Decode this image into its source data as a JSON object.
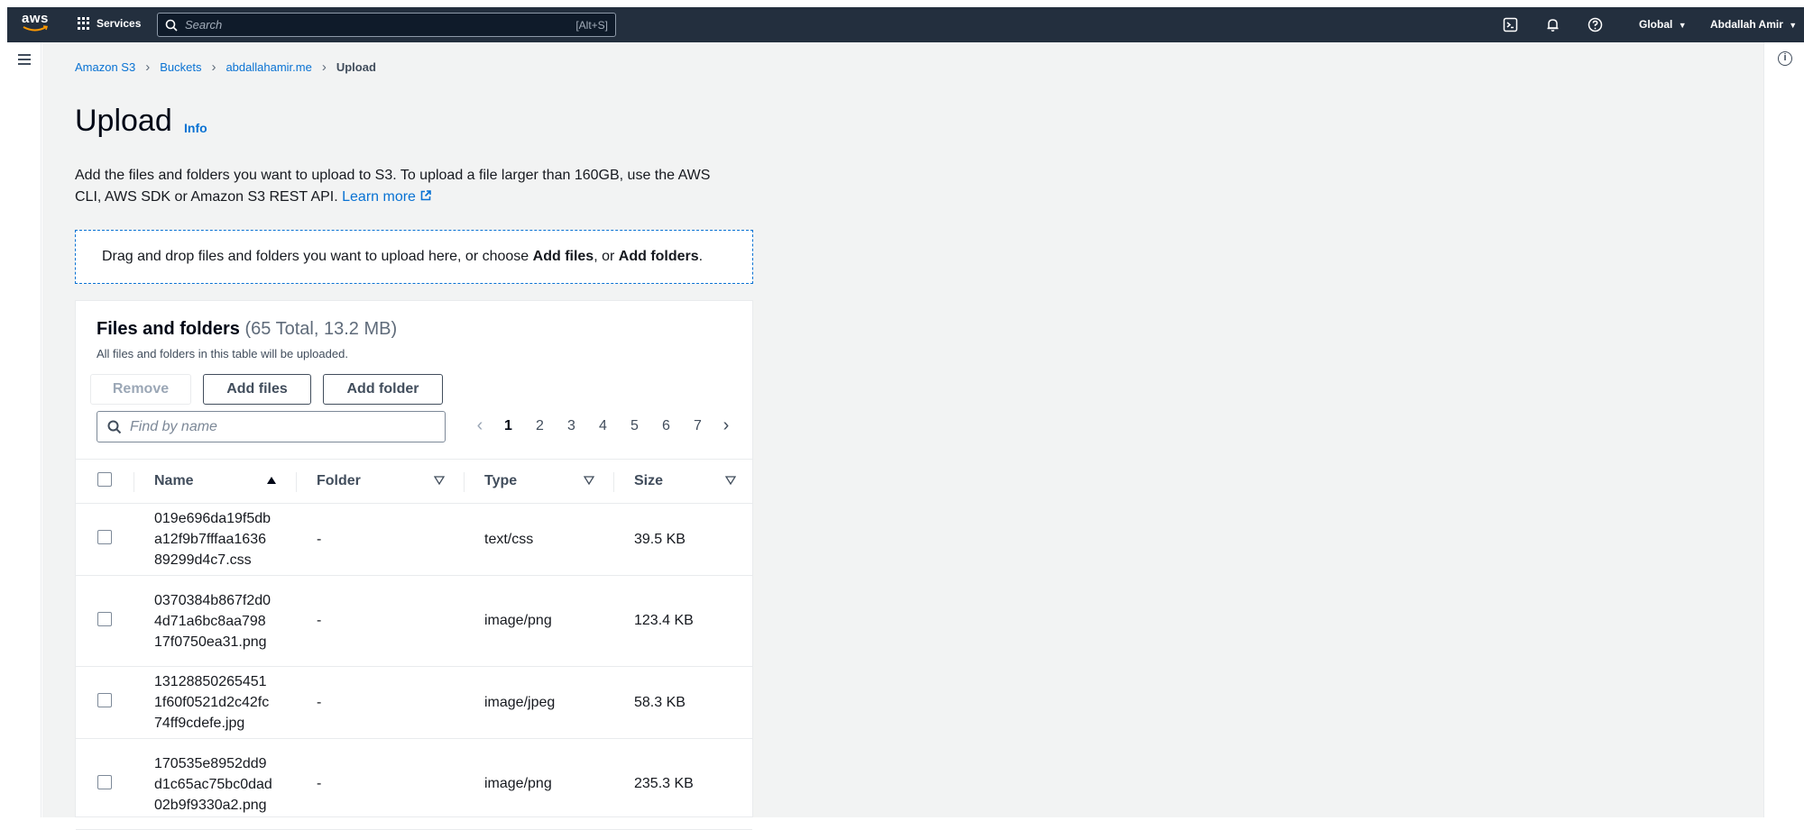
{
  "topbar": {
    "logo_text": "aws",
    "services_label": "Services",
    "search_placeholder": "Search",
    "search_shortcut": "[Alt+S]",
    "region": "Global",
    "user": "Abdallah Amir"
  },
  "breadcrumb": [
    "Amazon S3",
    "Buckets",
    "abdallahamir.me",
    "Upload"
  ],
  "page": {
    "title": "Upload",
    "info_link": "Info",
    "description_line1": "Add the files and folders you want to upload to S3. To upload a file larger than 160GB, use the AWS",
    "description_line2": "CLI, AWS SDK or Amazon S3 REST API.",
    "learn_more": "Learn more",
    "dropzone_pre": "Drag and drop files and folders you want to upload here, or choose ",
    "dropzone_add_files": "Add files",
    "dropzone_mid": ", or ",
    "dropzone_add_folders": "Add folders",
    "dropzone_post": "."
  },
  "panel": {
    "title": "Files and folders",
    "count": "(65 Total, 13.2 MB)",
    "subtitle": "All files and folders in this table will be uploaded.",
    "remove_label": "Remove",
    "add_files_label": "Add files",
    "add_folder_label": "Add folder",
    "find_placeholder": "Find by name",
    "pages": [
      "1",
      "2",
      "3",
      "4",
      "5",
      "6",
      "7"
    ],
    "current_page": "1",
    "columns": [
      "Name",
      "Folder",
      "Type",
      "Size"
    ],
    "rows": [
      {
        "name": "019e696da19f5dba12f9b7fffaa163689299d4c7.css",
        "folder": "-",
        "type": "text/css",
        "size": "39.5 KB"
      },
      {
        "name": "0370384b867f2d04d71a6bc8aa79817f0750ea31.png",
        "folder": "-",
        "type": "image/png",
        "size": "123.4 KB"
      },
      {
        "name": "131288502654511f60f0521d2c42fc74ff9cdefe.jpg",
        "folder": "-",
        "type": "image/jpeg",
        "size": "58.3 KB"
      },
      {
        "name": "170535e8952dd9d1c65ac75bc0dad02b9f9330a2.png",
        "folder": "-",
        "type": "image/png",
        "size": "235.3 KB"
      }
    ]
  },
  "colors": {
    "topbar_bg": "#232f3e",
    "link": "#0972d3",
    "page_bg": "#f2f3f3"
  }
}
